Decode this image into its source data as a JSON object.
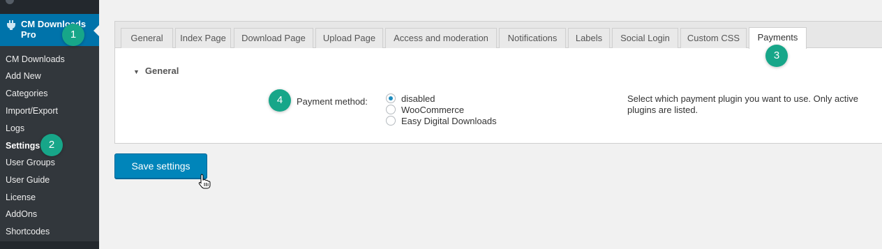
{
  "sidebar": {
    "menu_title": "CM Downloads Pro",
    "items": [
      {
        "label": "CM Downloads"
      },
      {
        "label": "Add New"
      },
      {
        "label": "Categories"
      },
      {
        "label": "Import/Export"
      },
      {
        "label": "Logs"
      },
      {
        "label": "Settings",
        "current": true
      },
      {
        "label": "User Groups"
      },
      {
        "label": "User Guide"
      },
      {
        "label": "License"
      },
      {
        "label": "AddOns"
      },
      {
        "label": "Shortcodes"
      }
    ]
  },
  "badges": [
    "1",
    "2",
    "3",
    "4"
  ],
  "tabs": [
    {
      "label": "General"
    },
    {
      "label": "Index Page"
    },
    {
      "label": "Download Page"
    },
    {
      "label": "Upload Page"
    },
    {
      "label": "Access and moderation"
    },
    {
      "label": "Notifications"
    },
    {
      "label": "Labels"
    },
    {
      "label": "Social Login"
    },
    {
      "label": "Custom CSS"
    },
    {
      "label": "Payments",
      "active": true
    }
  ],
  "section": {
    "heading": "General"
  },
  "payment": {
    "label": "Payment method:",
    "options": [
      "disabled",
      "WooCommerce",
      "Easy Digital Downloads"
    ],
    "selected": "disabled",
    "help": "Select which payment plugin you want to use. Only active plugins are listed."
  },
  "actions": {
    "save_label": "Save settings"
  },
  "colors": {
    "admin_bar": "#23282d",
    "submenu": "#32373c",
    "accent": "#0073aa",
    "button": "#0085ba",
    "badge": "#17a689"
  }
}
